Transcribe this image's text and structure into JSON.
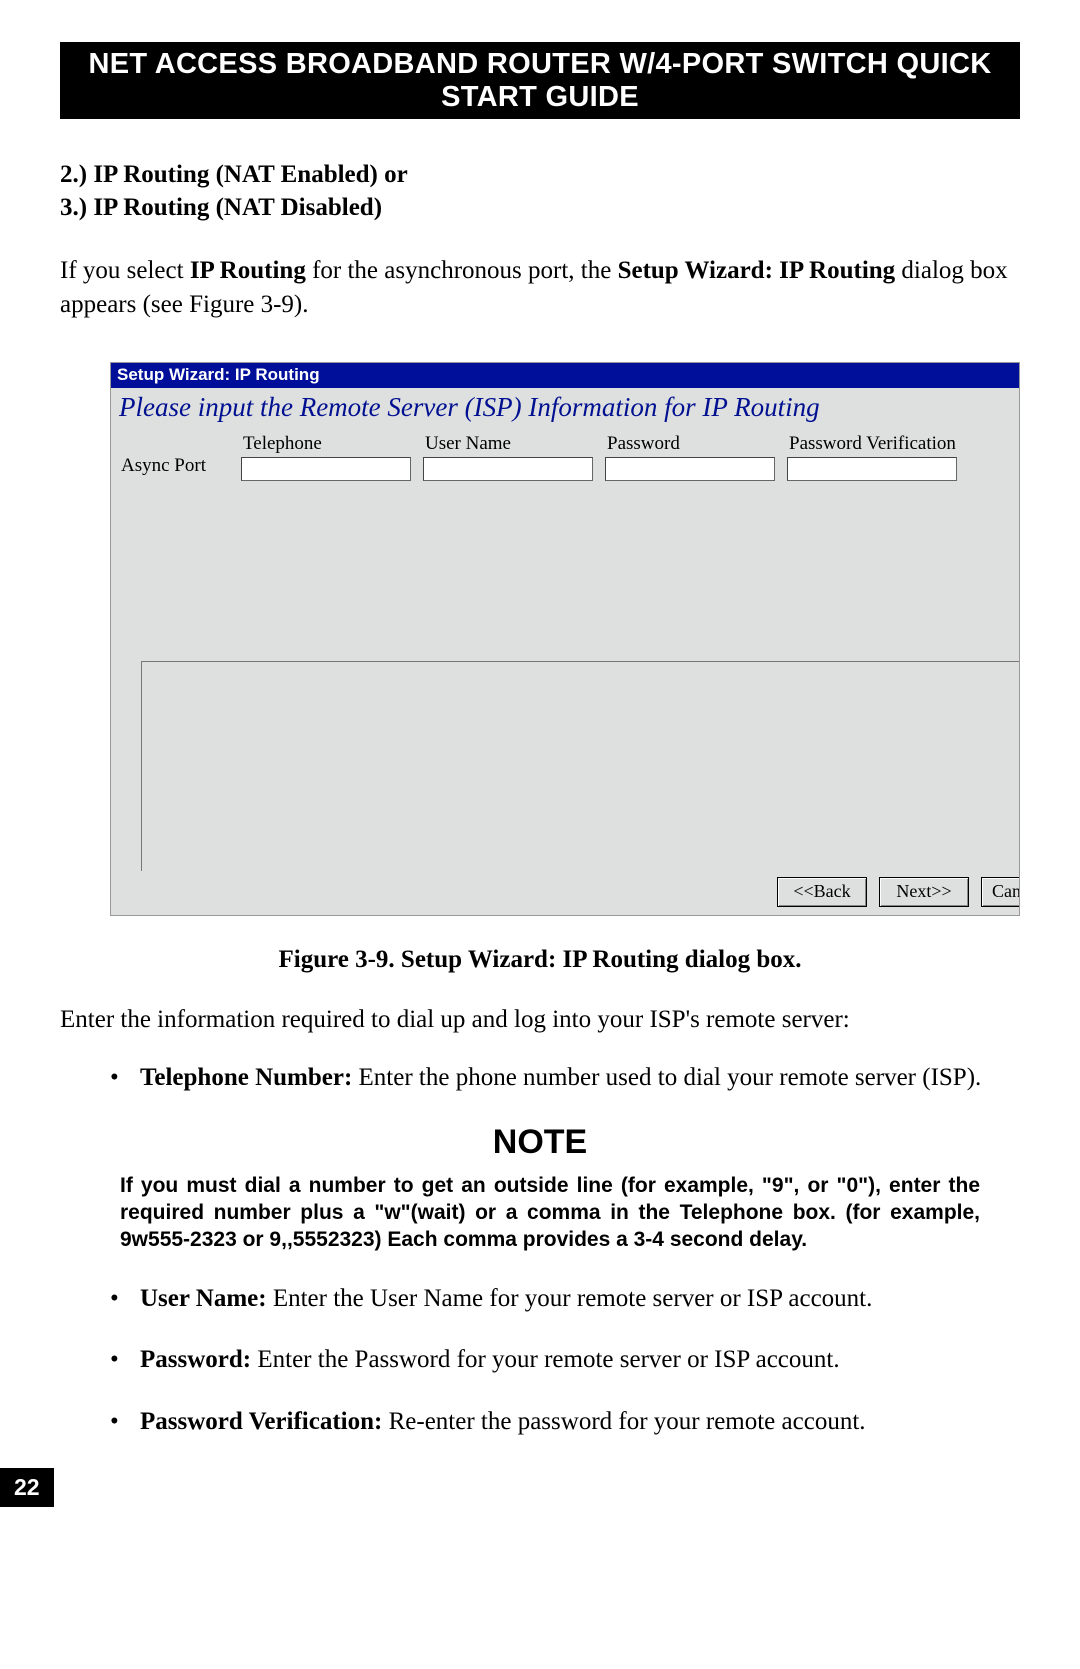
{
  "header": {
    "title": "NET ACCESS BROADBAND ROUTER W/4-PORT SWITCH QUICK START GUIDE"
  },
  "section": {
    "line1": "2.) IP Routing (NAT Enabled) or",
    "line2": "3.) IP Routing (NAT Disabled)"
  },
  "intro": {
    "prefix": "If you select ",
    "bold1": "IP Routing",
    "mid": " for the asynchronous port, the ",
    "bold2": "Setup Wizard: IP Routing",
    "suffix": " dialog box appears (see Figure 3-9)."
  },
  "dialog": {
    "titlebar": "Setup Wizard: IP Routing",
    "heading": "Please input the Remote Server (ISP) Information for IP Routing",
    "row_label": "Async Port",
    "columns": {
      "telephone": {
        "label": "Telephone",
        "value": ""
      },
      "user_name": {
        "label": "User Name",
        "value": ""
      },
      "password": {
        "label": "Password",
        "value": ""
      },
      "password_verify": {
        "label": "Password Verification",
        "value": ""
      }
    },
    "buttons": {
      "back": "<<Back",
      "next": "Next>>",
      "cancel": "Can"
    }
  },
  "figure_caption": "Figure 3-9. Setup Wizard: IP Routing dialog box.",
  "instruction": "Enter the information required to dial up and log into your ISP's remote server:",
  "bullet_telephone": {
    "label": "Telephone Number:",
    "text": " Enter the phone number used to dial your remote server (ISP)."
  },
  "note": {
    "heading": "NOTE",
    "body": "If you must dial a number to get an outside line (for example, \"9\", or \"0\"), enter the required number plus a \"w\"(wait) or a comma in the Telephone box. (for example, 9w555-2323 or 9,,5552323) Each comma provides a 3-4 second delay."
  },
  "bullet_username": {
    "label": "User Name:",
    "text": " Enter the User Name for your remote server or ISP account."
  },
  "bullet_password": {
    "label": "Password:",
    "text": " Enter the Password for your remote server or ISP account."
  },
  "bullet_passverify": {
    "label": "Password Verification:",
    "text": " Re-enter the password for your remote account."
  },
  "page_number": "22"
}
